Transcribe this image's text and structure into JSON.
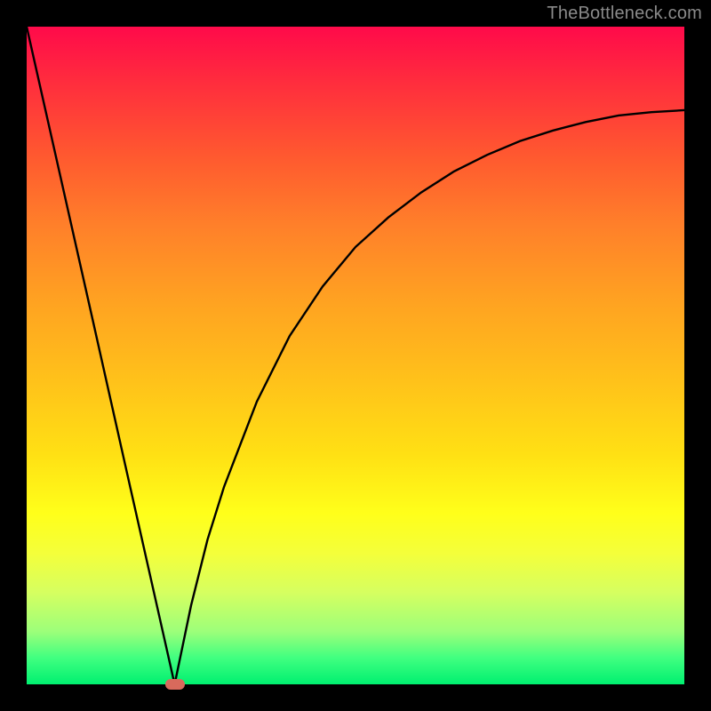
{
  "watermark": {
    "text": "TheBottleneck.com"
  },
  "chart_data": {
    "type": "line",
    "title": "",
    "xlabel": "",
    "ylabel": "",
    "xlim": [
      0,
      100
    ],
    "ylim": [
      0,
      100
    ],
    "background_gradient": {
      "top": "#ff0a4a",
      "bottom": "#00f070",
      "stops": [
        "red",
        "orange",
        "yellow",
        "green"
      ]
    },
    "series": [
      {
        "name": "left-branch",
        "x": [
          0,
          5,
          10,
          15,
          20,
          22.5
        ],
        "values": [
          100,
          77.8,
          55.6,
          33.3,
          11.1,
          0
        ]
      },
      {
        "name": "right-branch",
        "x": [
          22.5,
          25,
          27.5,
          30,
          35,
          40,
          45,
          50,
          55,
          60,
          65,
          70,
          75,
          80,
          85,
          90,
          95,
          100
        ],
        "values": [
          0,
          12,
          22,
          30,
          43,
          53,
          60.5,
          66.5,
          71,
          74.8,
          78,
          80.5,
          82.6,
          84.2,
          85.5,
          86.5,
          87,
          87.3
        ]
      }
    ],
    "marker": {
      "x": 22.5,
      "y": 0,
      "color": "#d86a5c"
    },
    "grid": false,
    "legend": false
  }
}
